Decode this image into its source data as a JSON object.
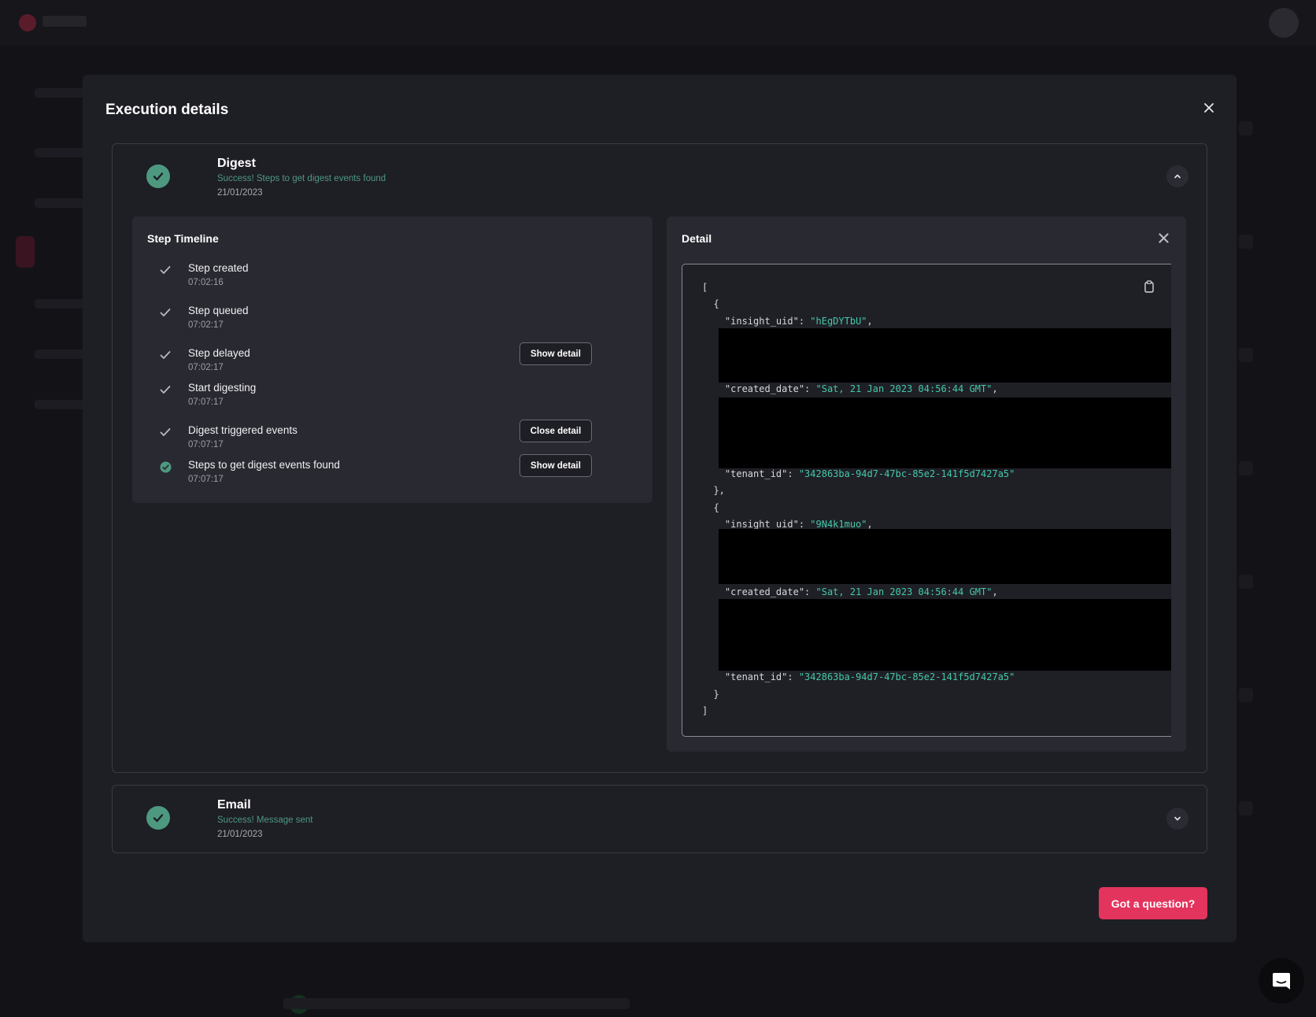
{
  "modal": {
    "title": "Execution details",
    "close_icon": "close-icon"
  },
  "steps": [
    {
      "name": "Digest",
      "status_text": "Success! Steps to get digest events found",
      "date": "21/01/2023",
      "expanded": true,
      "status_color": "#4d9980"
    },
    {
      "name": "Email",
      "status_text": "Success! Message sent",
      "date": "21/01/2023",
      "expanded": false,
      "status_color": "#4d9980"
    }
  ],
  "timeline": {
    "title": "Step Timeline",
    "items": [
      {
        "label": "Step created",
        "time": "07:02:16",
        "icon": "check-icon",
        "button": ""
      },
      {
        "label": "Step queued",
        "time": "07:02:17",
        "icon": "check-icon",
        "button": ""
      },
      {
        "label": "Step delayed",
        "time": "07:02:17",
        "icon": "check-icon",
        "button": "Show detail"
      },
      {
        "label": "Start digesting",
        "time": "07:07:17",
        "icon": "check-icon",
        "button": ""
      },
      {
        "label": "Digest triggered events",
        "time": "07:07:17",
        "icon": "check-icon",
        "button": "Close detail"
      },
      {
        "label": "Steps to get digest events found",
        "time": "07:07:17",
        "icon": "check-circle-icon",
        "button": "Show detail"
      }
    ]
  },
  "detail": {
    "title": "Detail",
    "lines": {
      "l1": "[",
      "l2": "  {",
      "l3_key": "    \"insight_uid\"",
      "l3_sep": ": ",
      "l3_val": "\"hEgDYTbU\"",
      "l3_end": ",",
      "l4_key": "    \"created_date\"",
      "l4_sep": ": ",
      "l4_val": "\"Sat, 21 Jan 2023 04:56:44 GMT\"",
      "l4_end": ",",
      "l5_key": "    \"tenant_id\"",
      "l5_sep": ": ",
      "l5_val": "\"342863ba-94d7-47bc-85e2-141f5d7427a5\"",
      "l6": "  },",
      "l7": "  {",
      "l8_key": "    \"insight_uid\"",
      "l8_sep": ": ",
      "l8_val": "\"9N4k1muo\"",
      "l8_end": ",",
      "l9_key": "    \"created_date\"",
      "l9_sep": ": ",
      "l9_val": "\"Sat, 21 Jan 2023 04:56:44 GMT\"",
      "l9_end": ",",
      "l10_key": "    \"tenant_id\"",
      "l10_sep": ": ",
      "l10_val": "\"342863ba-94d7-47bc-85e2-141f5d7427a5\"",
      "l11": "  }",
      "l12": "]"
    }
  },
  "footer": {
    "question_button": "Got a question?"
  },
  "colors": {
    "accent": "#e3345e",
    "success": "#4d9980",
    "json_string": "#43c9a9"
  }
}
